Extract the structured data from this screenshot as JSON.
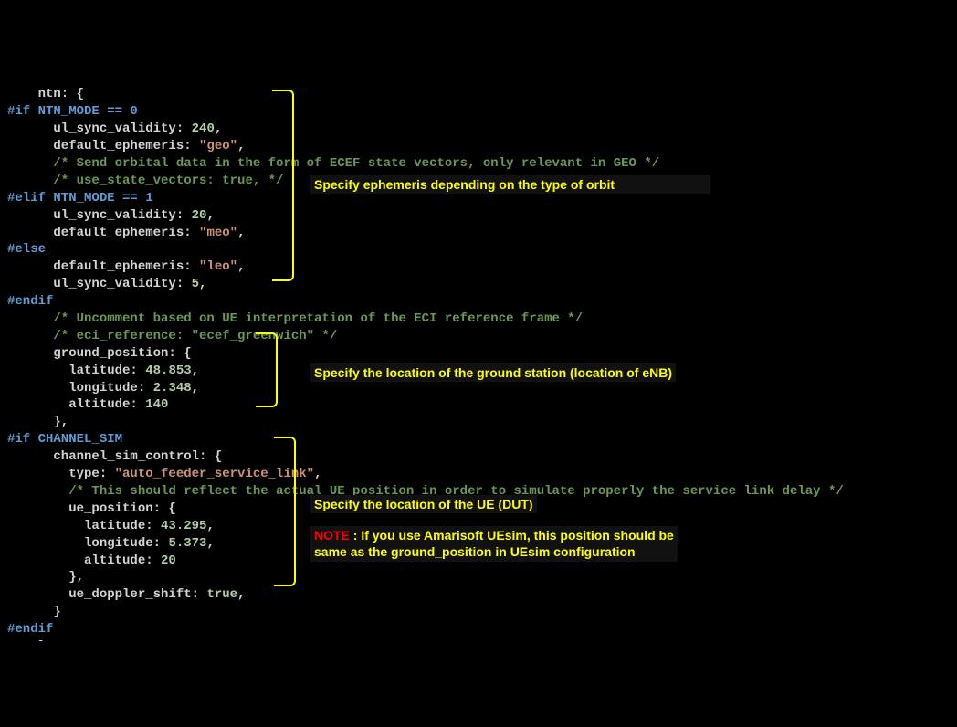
{
  "code": {
    "l1": "    ntn: {",
    "pp1": "#if NTN_MODE == 0",
    "l2a": "      ul_sync_validity: ",
    "l2b": "240",
    "l2c": ",",
    "l3a": "      default_ephemeris: ",
    "l3b": "\"geo\"",
    "l3c": ",",
    "c1": "      /* Send orbital data in the form of ECEF state vectors, only relevant in GEO */",
    "c2": "      /* use_state_vectors: true, */",
    "pp2": "#elif NTN_MODE == 1",
    "l4a": "      ul_sync_validity: ",
    "l4b": "20",
    "l4c": ",",
    "l5a": "      default_ephemeris: ",
    "l5b": "\"meo\"",
    "l5c": ",",
    "pp3": "#else",
    "l6a": "      default_ephemeris: ",
    "l6b": "\"leo\"",
    "l6c": ",",
    "l7a": "      ul_sync_validity: ",
    "l7b": "5",
    "l7c": ",",
    "pp4": "#endif",
    "c3": "      /* Uncomment based on UE interpretation of the ECI reference frame */",
    "c4": "      /* eci_reference: \"ecef_greenwich\" */",
    "l8": "      ground_position: {",
    "l9a": "        latitude: ",
    "l9b": "48.853",
    "l9c": ",",
    "l10a": "        longitude: ",
    "l10b": "2.348",
    "l10c": ",",
    "l11a": "        altitude: ",
    "l11b": "140",
    "l12": "      },",
    "pp5": "#if CHANNEL_SIM",
    "l13": "      channel_sim_control: {",
    "l14a": "        type: ",
    "l14b": "\"auto_feeder_service_link\"",
    "l14c": ",",
    "c5": "        /* This should reflect the actual UE position in order to simulate properly the service link delay */",
    "l15": "        ue_position: {",
    "l16a": "          latitude: ",
    "l16b": "43.295",
    "l16c": ",",
    "l17a": "          longitude: ",
    "l17b": "5.373",
    "l17c": ",",
    "l18a": "          altitude: ",
    "l18b": "20",
    "l19": "        },",
    "l20a": "        ue_doppler_shift: ",
    "l20b": "true",
    "l20c": ",",
    "l21": "      }",
    "pp6": "#endif",
    "l22": "    },"
  },
  "annotations": {
    "a1": "Specify ephemeris depending on the type of orbit",
    "a2": "Specify the location of the ground station (location of eNB)",
    "a3": "Specify the location of the UE (DUT)",
    "note_label": "NOTE",
    "note_text1": " : If you use Amarisoft UEsim, this position should be",
    "note_text2": "same as the ground_position in UEsim configuration"
  }
}
